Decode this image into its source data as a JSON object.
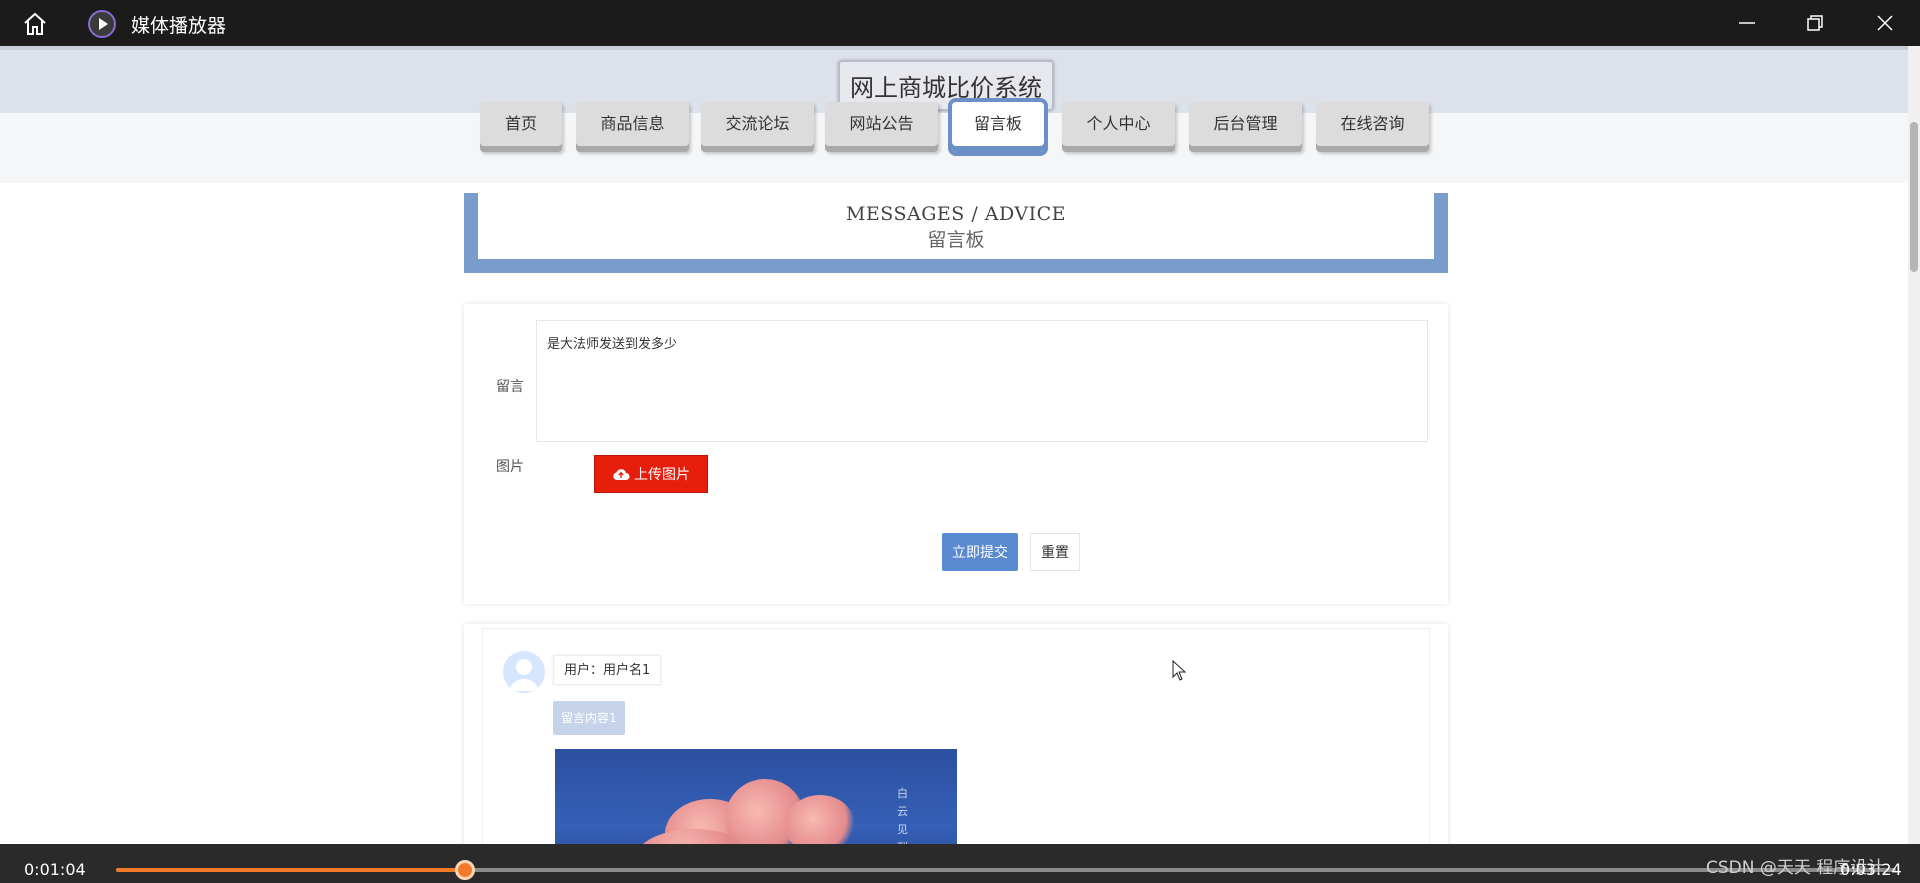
{
  "player": {
    "app_title": "媒体播放器",
    "current_time": "0:01:04",
    "total_time": "0:03:24",
    "progress": 0.196,
    "watermark": "CSDN @天天 程序设计",
    "accent": "#f27b2a"
  },
  "site": {
    "title": "网上商城比价系统"
  },
  "nav": {
    "items": [
      {
        "label": "首页"
      },
      {
        "label": "商品信息"
      },
      {
        "label": "交流论坛"
      },
      {
        "label": "网站公告"
      },
      {
        "label": "留言板",
        "active": true
      },
      {
        "label": "个人中心"
      },
      {
        "label": "后台管理"
      },
      {
        "label": "在线咨询"
      }
    ]
  },
  "section": {
    "title_en": "MESSAGES / ADVICE",
    "title_zh": "留言板"
  },
  "form": {
    "message_label": "留言",
    "message_value": "是大法师发送到发多少",
    "image_label": "图片",
    "upload_label": "上传图片",
    "submit_label": "立即提交",
    "reset_label": "重置"
  },
  "messages": [
    {
      "user": "用户：用户名1",
      "content": "留言内容1",
      "photo_text": "白云见到了我"
    }
  ],
  "icons": {
    "home": "home-icon",
    "app": "play-icon",
    "upload": "cloud-upload-icon",
    "minimize": "minimize-icon",
    "restore": "restore-icon",
    "close": "close-icon"
  }
}
